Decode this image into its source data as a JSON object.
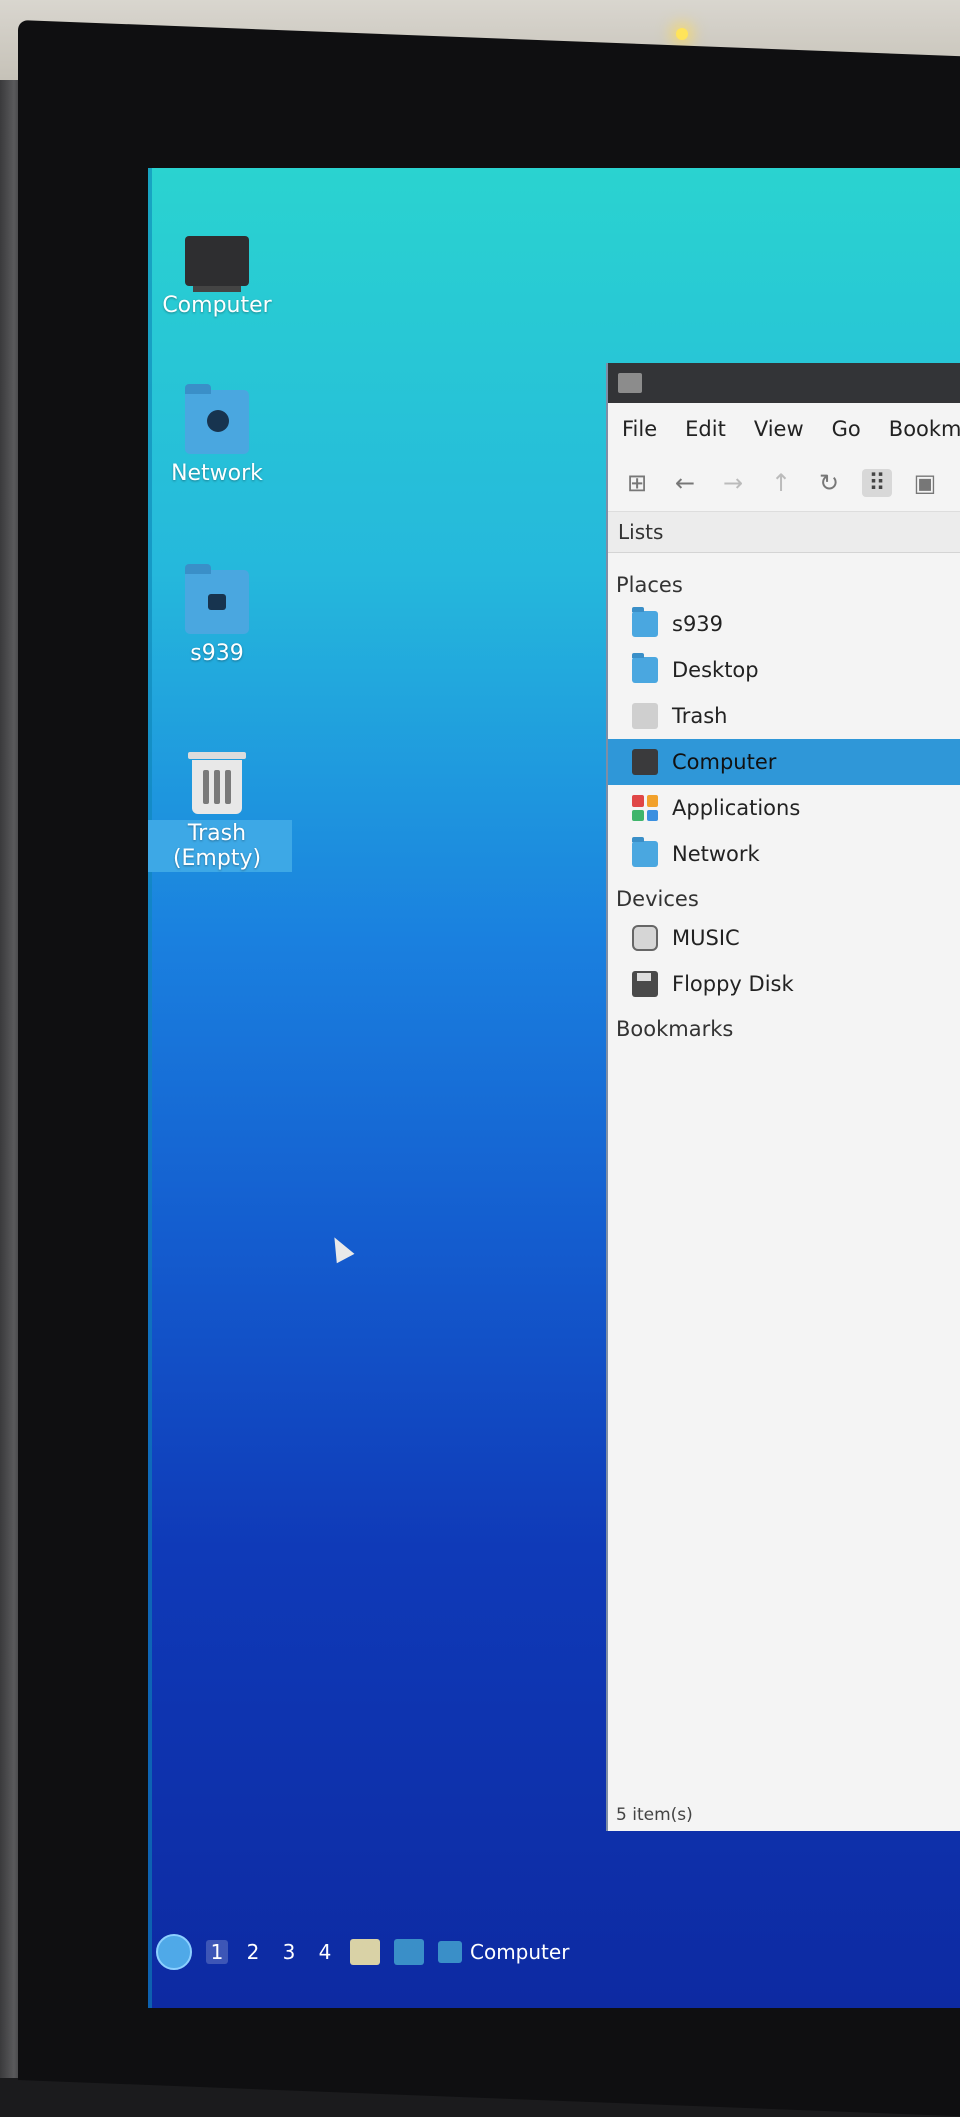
{
  "desktop": {
    "icons": [
      {
        "label": "Computer",
        "icon": "computer-icon"
      },
      {
        "label": "Network",
        "icon": "network-folder-icon"
      },
      {
        "label": "s939",
        "icon": "home-folder-icon"
      },
      {
        "label": "Trash (Empty)",
        "icon": "trash-icon",
        "selected": true
      }
    ]
  },
  "file_manager": {
    "menu": [
      "File",
      "Edit",
      "View",
      "Go",
      "Bookma"
    ],
    "toolbar": [
      "new-tab-icon",
      "back-icon",
      "forward-icon",
      "up-icon",
      "reload-icon",
      "icon-view-icon",
      "thumbnail-view-icon"
    ],
    "side_header": "Lists",
    "sections": {
      "places": {
        "title": "Places",
        "items": [
          "s939",
          "Desktop",
          "Trash",
          "Computer",
          "Applications",
          "Network"
        ]
      },
      "devices": {
        "title": "Devices",
        "items": [
          "MUSIC",
          "Floppy Disk"
        ]
      },
      "bookmarks": {
        "title": "Bookmarks"
      }
    },
    "selected_item": "Computer",
    "status": "5 item(s)"
  },
  "taskbar": {
    "workspaces": [
      "1",
      "2",
      "3",
      "4"
    ],
    "current_workspace": "1",
    "task_label": "Computer"
  },
  "colors": {
    "selection": "#2f97d8",
    "titlebar": "#333437",
    "desktop_top": "#2ad3d0",
    "desktop_bottom": "#0d2aa2"
  }
}
